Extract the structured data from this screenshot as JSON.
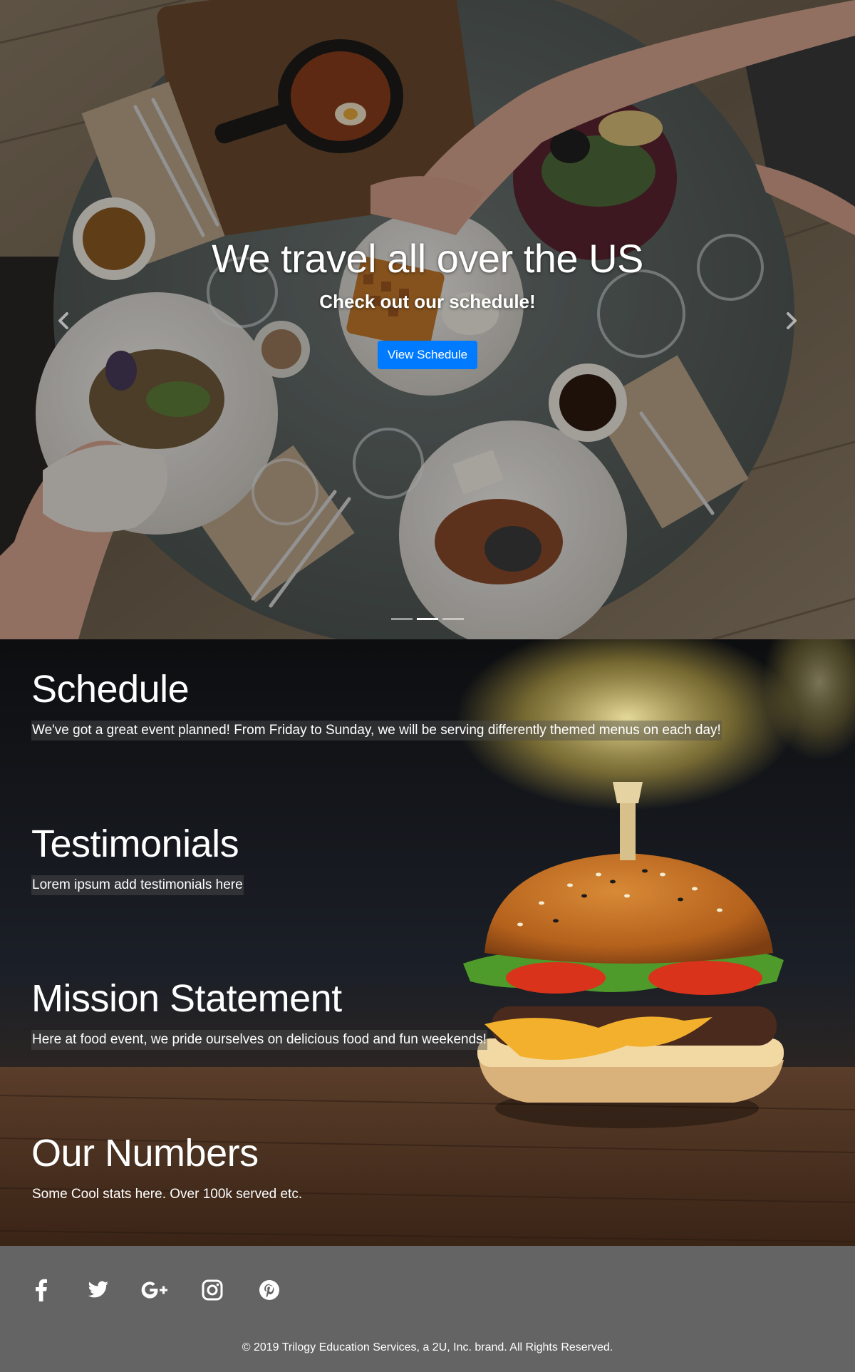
{
  "hero": {
    "title": "We travel all over the US",
    "subtitle": "Check out our schedule!",
    "button_label": "View Schedule",
    "active_slide": 2,
    "slide_count": 3,
    "image": "overhead view of breakfast table with waffles, skillet eggs, coffee cups and plates"
  },
  "sections": {
    "schedule": {
      "title": "Schedule",
      "text": "We've got a great event planned! From Friday to Sunday, we will be serving differently themed menus on each day!"
    },
    "testimonials": {
      "title": "Testimonials",
      "text": "Lorem ipsum add testimonials here"
    },
    "mission": {
      "title": "Mission Statement",
      "text": "Here at food event, we pride ourselves on delicious food and fun weekends!"
    },
    "numbers": {
      "title": "Our Numbers",
      "text": "Some Cool stats here. Over 100k served etc."
    },
    "background_image": "cheeseburger on wooden table"
  },
  "footer": {
    "social": [
      "facebook-icon",
      "twitter-icon",
      "google-plus-icon",
      "instagram-icon",
      "pinterest-icon"
    ],
    "copyright": "© 2019 Trilogy Education Services, a 2U, Inc. brand. All Rights Reserved."
  },
  "colors": {
    "primary_button": "#007bff",
    "footer_bg": "#646464",
    "text": "#ffffff"
  }
}
